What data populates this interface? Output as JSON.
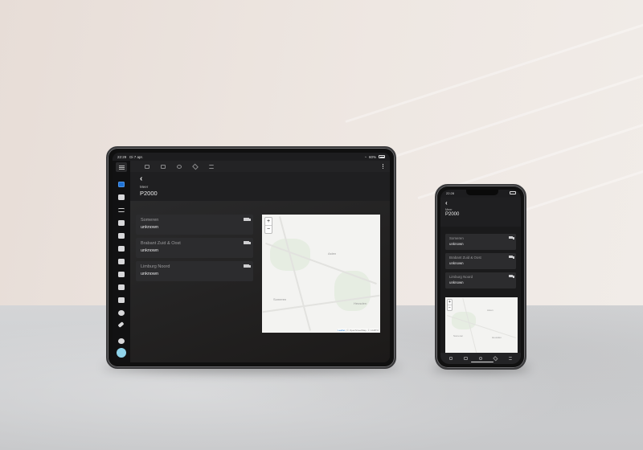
{
  "tablet": {
    "status": {
      "time": "22:29",
      "date": "Di 7 apr.",
      "battery": "60%"
    },
    "header": {
      "subtitle": "Meer",
      "title": "P2000"
    },
    "cards": [
      {
        "name": "Someren",
        "value": "unknown"
      },
      {
        "name": "Brabant Zuid & Oost",
        "value": "unknown"
      },
      {
        "name": "Limburg Noord",
        "value": "unknown"
      }
    ],
    "map": {
      "zoom_in": "+",
      "zoom_out": "−",
      "labels": [
        "Asten",
        "Someren",
        "Heusden"
      ],
      "attribution_leaflet": "Leaflet",
      "attribution_rest": "| © OpenStreetMap, © CARTO"
    }
  },
  "phone": {
    "status": {
      "time": "22:28"
    },
    "header": {
      "subtitle": "Meer",
      "title": "P2000"
    },
    "cards": [
      {
        "name": "Someren",
        "value": "unknown"
      },
      {
        "name": "Brabant Zuid & Oost",
        "value": "unknown"
      },
      {
        "name": "Limburg Noord",
        "value": "unknown"
      }
    ],
    "map": {
      "zoom_in": "+",
      "zoom_out": "−",
      "labels": [
        "Asten",
        "Someren",
        "Heusden"
      ]
    }
  },
  "icons": {
    "sidebar": [
      "overview-icon",
      "person-icon",
      "list-icon",
      "logbook-icon",
      "shield-icon",
      "energy-icon",
      "history-icon",
      "map-icon",
      "network-icon",
      "code-icon",
      "compass-icon",
      "hammer-icon",
      "bell-icon"
    ],
    "truck": "truck-icon"
  },
  "colors": {
    "accent": "#1f73d6",
    "avatar": "#8fd3ea",
    "card": "#2c2c2e",
    "map": "#f3f3f1"
  }
}
